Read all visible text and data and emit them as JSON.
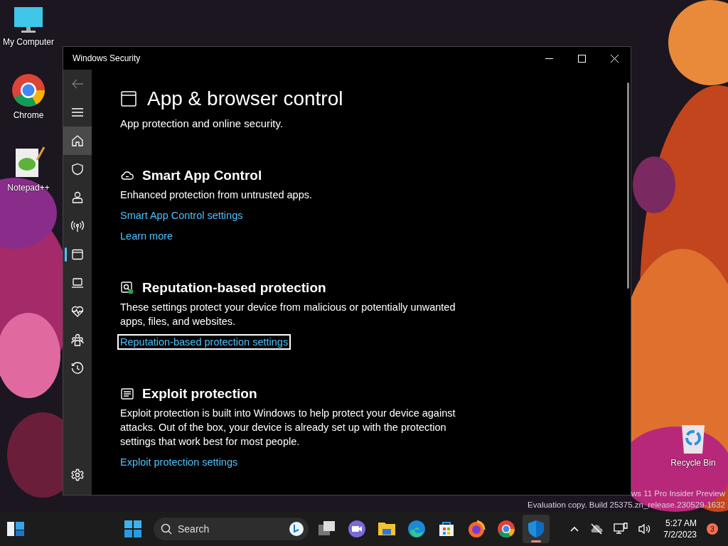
{
  "desktop_icons": [
    {
      "label": "My Computer",
      "kind": "computer"
    },
    {
      "label": "Chrome",
      "kind": "chrome"
    },
    {
      "label": "Notepad++",
      "kind": "notepad"
    },
    {
      "label": "Recycle Bin",
      "kind": "recycle"
    }
  ],
  "window": {
    "title": "Windows Security",
    "nav_items": [
      {
        "kind": "back",
        "selected": false,
        "hovered": false
      },
      {
        "kind": "menu",
        "selected": false,
        "hovered": false
      },
      {
        "kind": "home",
        "selected": false,
        "hovered": true
      },
      {
        "kind": "shield",
        "selected": false,
        "hovered": false
      },
      {
        "kind": "person",
        "selected": false,
        "hovered": false
      },
      {
        "kind": "wireless",
        "selected": false,
        "hovered": false
      },
      {
        "kind": "app",
        "selected": true,
        "hovered": false
      },
      {
        "kind": "laptop",
        "selected": false,
        "hovered": false
      },
      {
        "kind": "heart",
        "selected": false,
        "hovered": false
      },
      {
        "kind": "family",
        "selected": false,
        "hovered": false
      },
      {
        "kind": "history",
        "selected": false,
        "hovered": false
      },
      {
        "kind": "settings",
        "selected": false,
        "hovered": false
      }
    ],
    "page": {
      "title": "App & browser control",
      "subtitle": "App protection and online security.",
      "sections": [
        {
          "kind": "cloud",
          "title": "Smart App Control",
          "description": "Enhanced protection from untrusted apps.",
          "links": [
            {
              "text": "Smart App Control settings",
              "focused": false
            },
            {
              "text": "Learn more",
              "focused": false
            }
          ]
        },
        {
          "kind": "reputation",
          "title": "Reputation-based protection",
          "description": "These settings protect your device from malicious or potentially unwanted apps, files, and websites.",
          "links": [
            {
              "text": "Reputation-based protection settings",
              "focused": true
            }
          ]
        },
        {
          "kind": "exploit",
          "title": "Exploit protection",
          "description": "Exploit protection is built into Windows to help protect your device against attacks.  Out of the box, your device is already set up with the protection settings that work best for most people.",
          "links": [
            {
              "text": "Exploit protection settings",
              "focused": false
            }
          ]
        }
      ]
    }
  },
  "watermark": {
    "line_1": "ws 11 Pro Insider Preview",
    "line_2": "Evaluation copy. Build 25375.zn_release.230529-1632"
  },
  "taskbar": {
    "search": {
      "placeholder": "Search"
    },
    "apps": [
      {
        "kind": "taskview",
        "active": false
      },
      {
        "kind": "teams",
        "active": false
      },
      {
        "kind": "explorer",
        "active": false
      },
      {
        "kind": "edge",
        "active": false
      },
      {
        "kind": "store",
        "active": false
      },
      {
        "kind": "firefox",
        "active": false
      },
      {
        "kind": "chrome",
        "active": false
      },
      {
        "kind": "security",
        "active": true
      }
    ],
    "clock": {
      "time": "5:27 AM",
      "date": "7/2/2023"
    },
    "notification_count": "3"
  }
}
